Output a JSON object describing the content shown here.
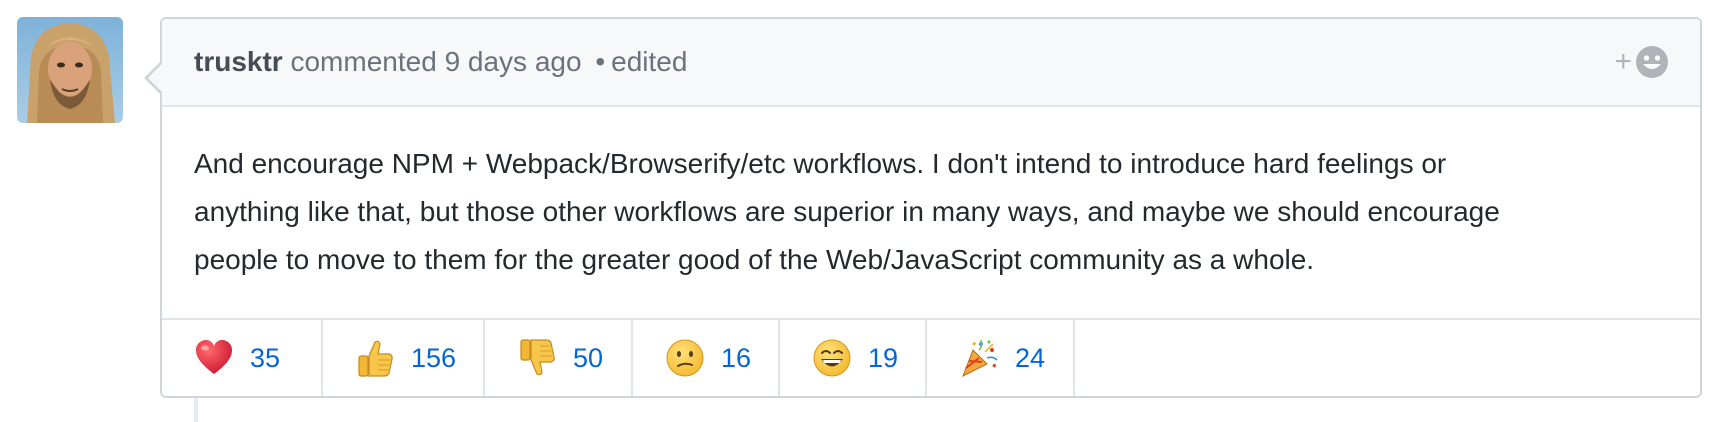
{
  "comment": {
    "author": "trusktr",
    "action": "commented",
    "time": "9 days ago",
    "separator": "•",
    "edited": "edited",
    "add_reaction_label": "+",
    "body_lines": [
      "And encourage NPM + Webpack/Browserify/etc workflows. I don't intend to introduce hard feelings or",
      "anything like that, but those other workflows are superior in many ways, and maybe we should encourage",
      "people to move to them for the greater good of the Web/JavaScript community as a whole."
    ]
  },
  "reactions": [
    {
      "icon": "heart-icon",
      "count": "35"
    },
    {
      "icon": "thumbs-up-icon",
      "count": "156"
    },
    {
      "icon": "thumbs-down-icon",
      "count": "50"
    },
    {
      "icon": "confused-face-icon",
      "count": "16"
    },
    {
      "icon": "smile-face-icon",
      "count": "19"
    },
    {
      "icon": "tada-icon",
      "count": "24"
    }
  ],
  "colors": {
    "link_blue": "#0366d6",
    "header_bg": "#f6f8fa",
    "border": "#d1d5da"
  }
}
